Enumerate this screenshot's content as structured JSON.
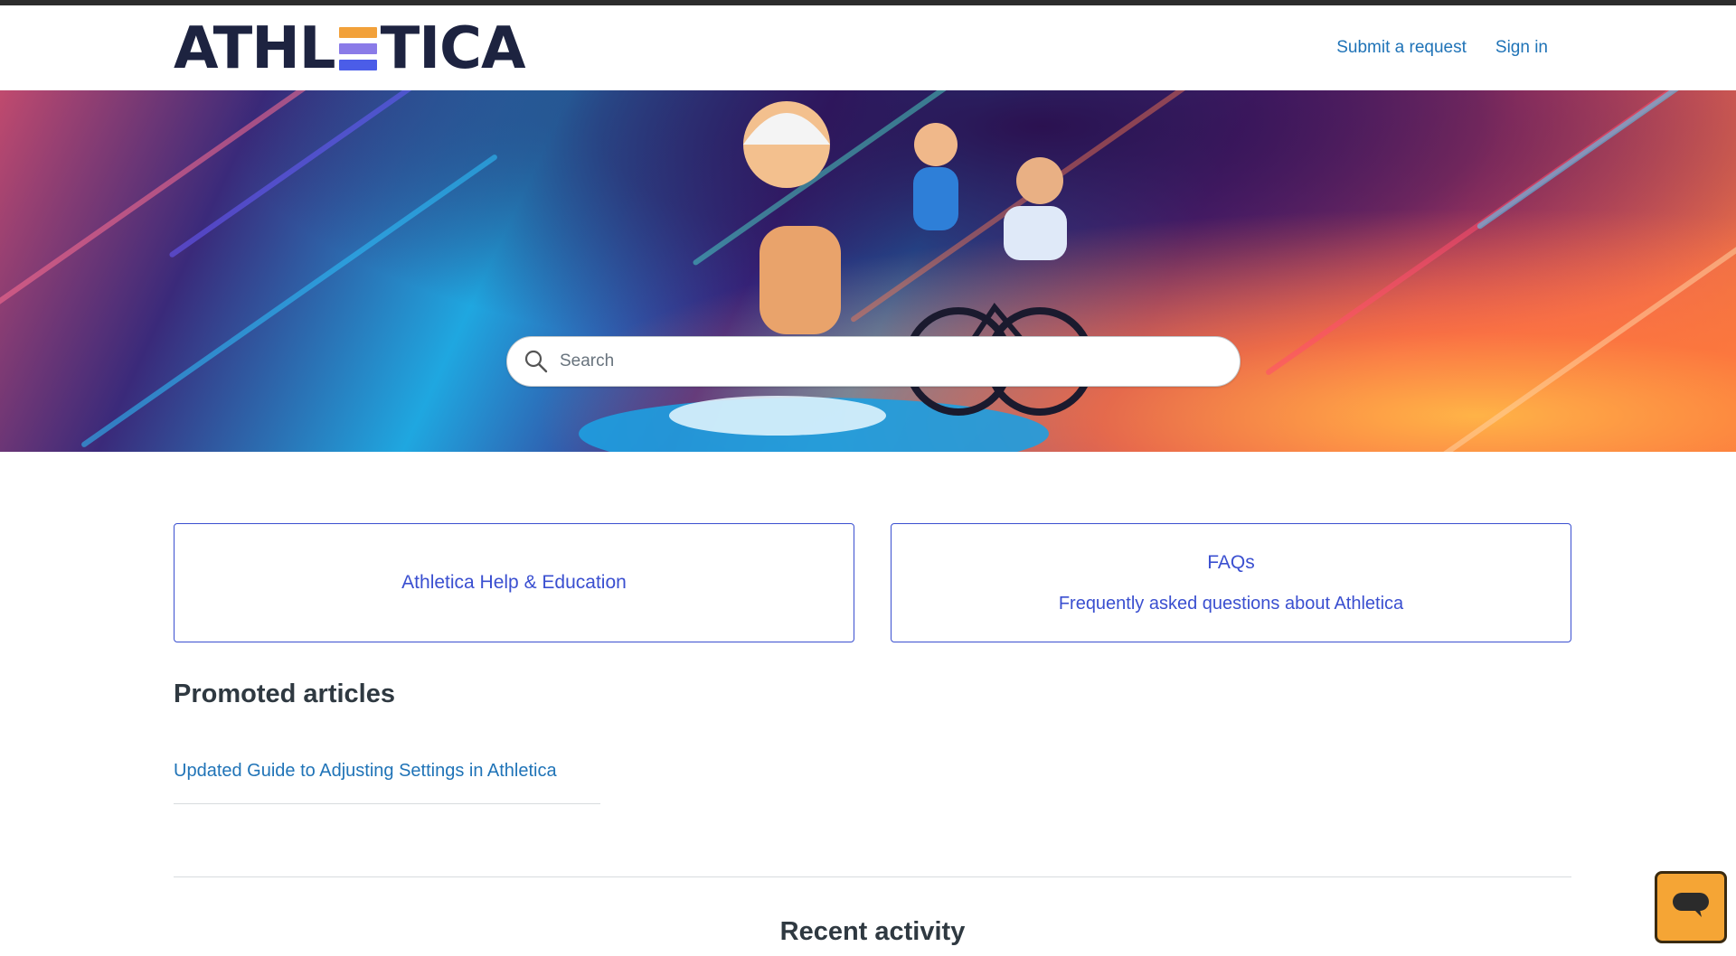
{
  "brand": {
    "logo_text_left": "ATHL",
    "logo_text_right": "TICA",
    "logo_e_colors": [
      "#f2a13a",
      "#8a7be8",
      "#4b5de8"
    ]
  },
  "nav": {
    "submit_request": "Submit a request",
    "sign_in": "Sign in"
  },
  "hero": {
    "search_placeholder": "Search"
  },
  "blocks": [
    {
      "title": "Athletica Help & Education",
      "description": ""
    },
    {
      "title": "FAQs",
      "description": "Frequently asked questions about Athletica"
    }
  ],
  "promoted": {
    "heading": "Promoted articles",
    "articles": [
      "Updated Guide to Adjusting Settings in Athletica"
    ]
  },
  "recent": {
    "heading": "Recent activity"
  },
  "colors": {
    "link": "#1f73b7",
    "block_border": "#3a4fd0",
    "chat_button": "#f5a535"
  }
}
